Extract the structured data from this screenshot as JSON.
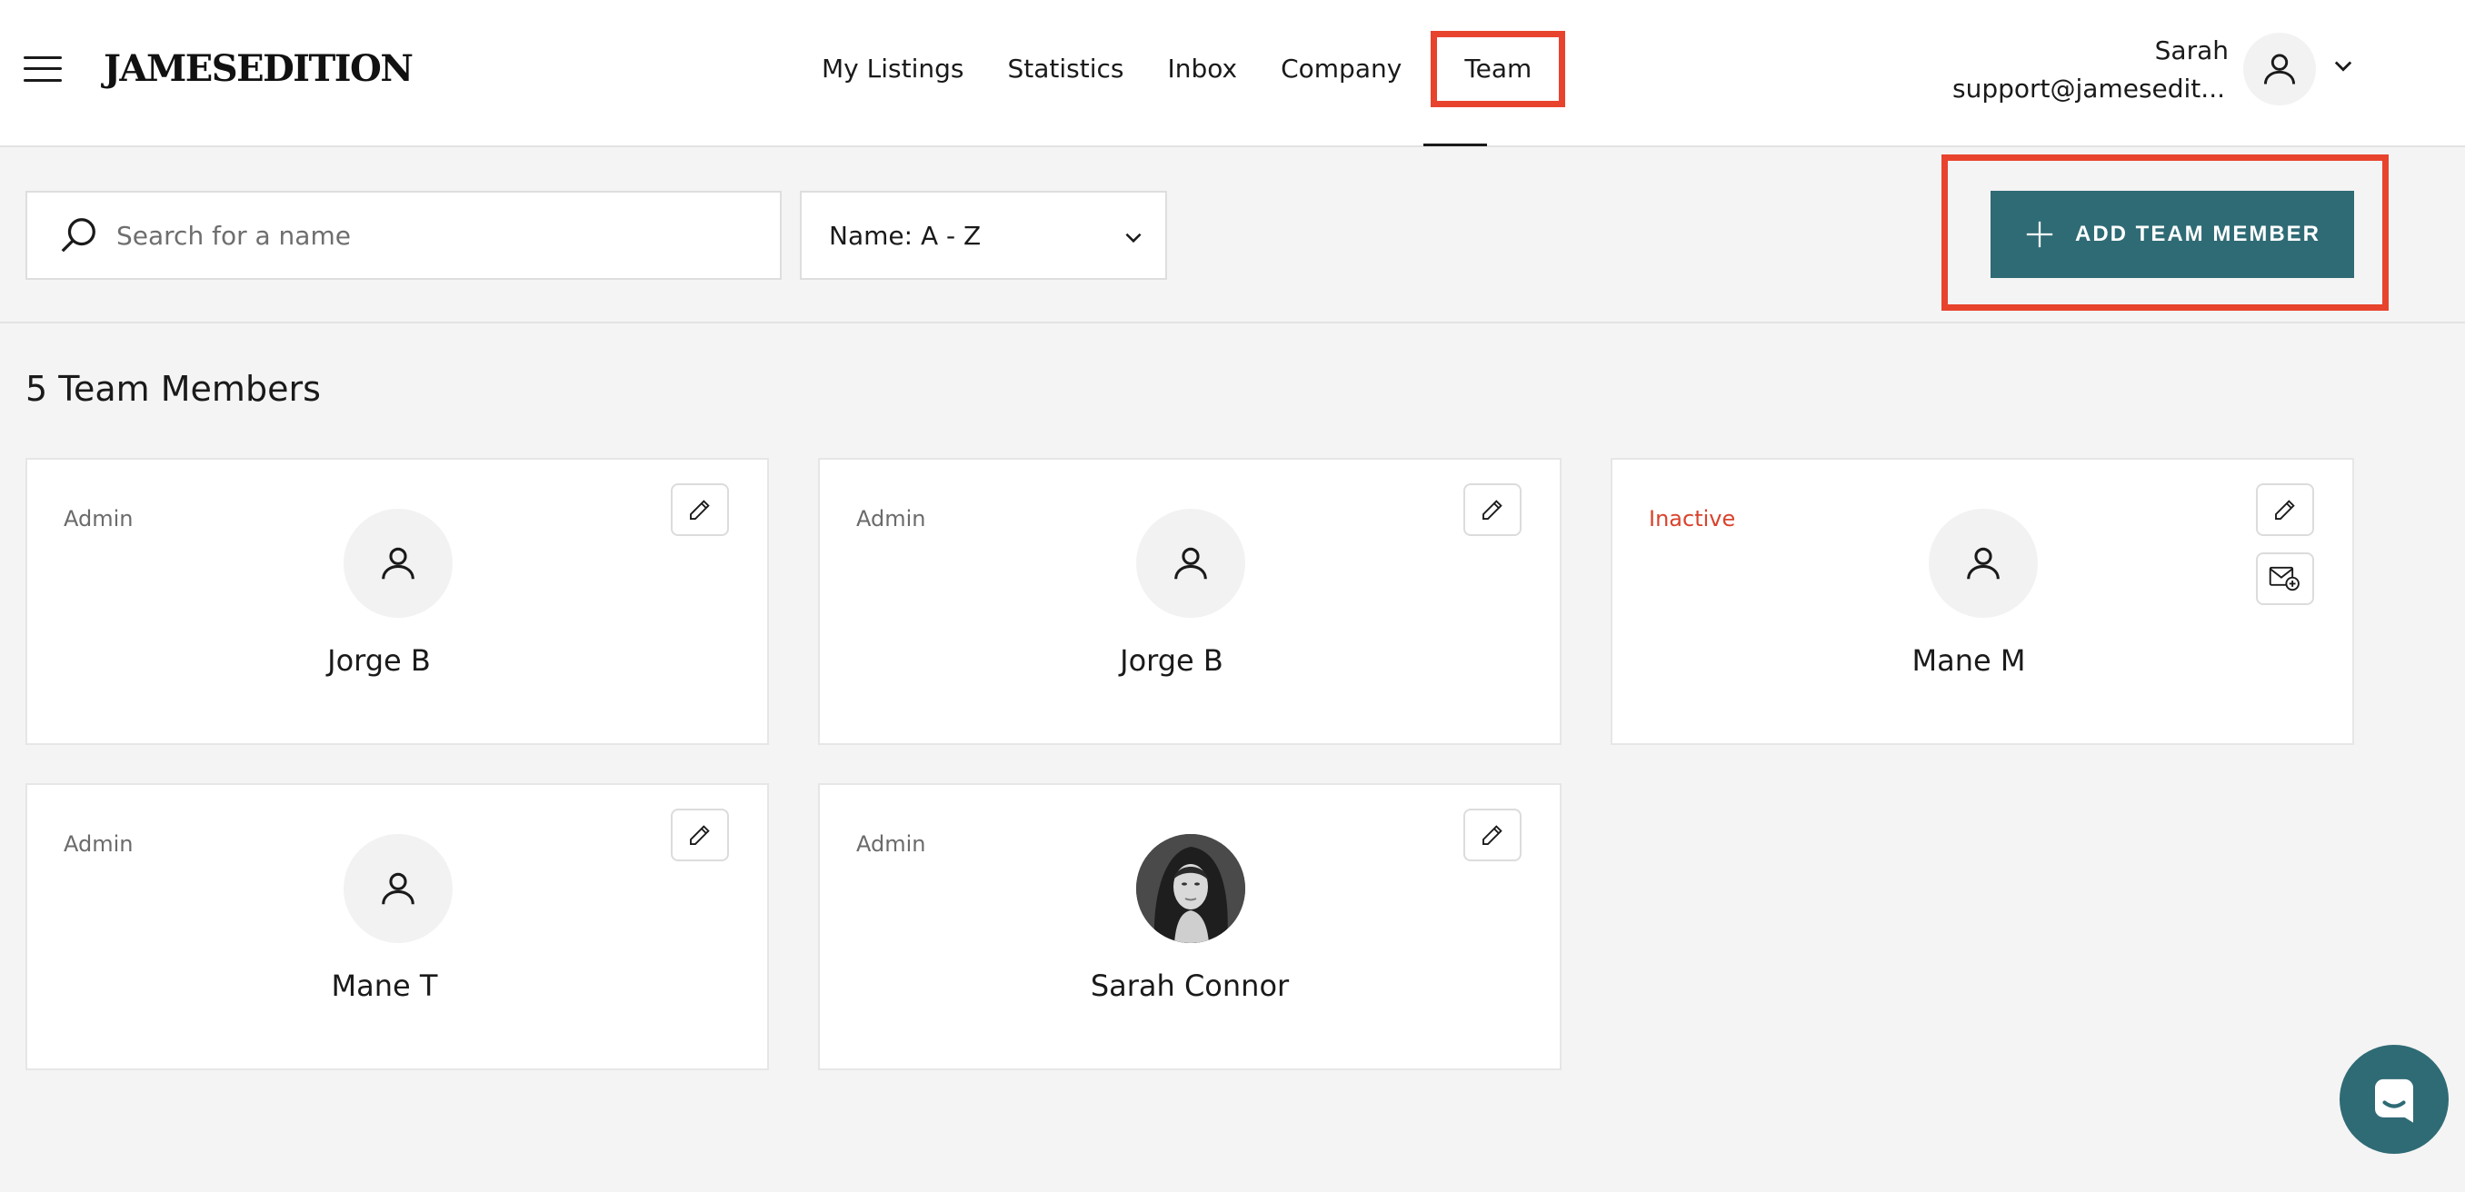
{
  "header": {
    "logo": "JAMESEDITION",
    "nav": [
      {
        "label": "My Listings"
      },
      {
        "label": "Statistics"
      },
      {
        "label": "Inbox"
      },
      {
        "label": "Company"
      },
      {
        "label": "Team",
        "active": true
      }
    ],
    "user": {
      "name": "Sarah",
      "email": "support@jamesedit..."
    }
  },
  "toolbar": {
    "search_placeholder": "Search for a name",
    "search_value": "",
    "sort_label": "Name: A - Z",
    "add_button_label": "ADD TEAM MEMBER"
  },
  "members": {
    "count_label": "5 Team Members",
    "cards": [
      {
        "role": "Admin",
        "name": "Jorge B",
        "avatar": "default-user-icon"
      },
      {
        "role": "Admin",
        "name": "Jorge B",
        "avatar": "default-user-icon"
      },
      {
        "role": "Inactive",
        "name": "Mane M",
        "avatar": "default-user-icon",
        "inactive": true,
        "resend_invite": true
      },
      {
        "role": "Admin",
        "name": "Mane T",
        "avatar": "default-user-icon"
      },
      {
        "role": "Admin",
        "name": "Sarah Connor",
        "avatar": "profile-photo"
      }
    ]
  },
  "colors": {
    "accent": "#2f6b75",
    "highlight": "#e8432d",
    "inactive": "#d9432d",
    "background": "#f4f4f4"
  }
}
